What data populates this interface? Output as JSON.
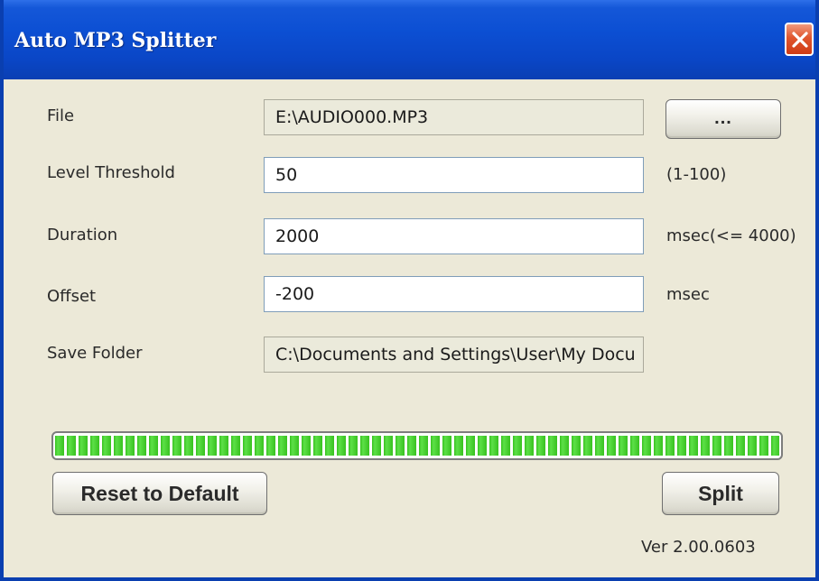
{
  "window": {
    "title": "Auto MP3 Splitter"
  },
  "form": {
    "file": {
      "label": "File",
      "value": "E:\\AUDIO000.MP3",
      "browse_label": "..."
    },
    "level_threshold": {
      "label": "Level Threshold",
      "value": "50",
      "unit": "(1-100)"
    },
    "duration": {
      "label": "Duration",
      "value": "2000",
      "unit": "msec(<= 4000)"
    },
    "offset": {
      "label": "Offset",
      "value": "-200",
      "unit": "msec"
    },
    "save_folder": {
      "label": "Save Folder",
      "value": "C:\\Documents and Settings\\User\\My Docu"
    }
  },
  "progress": {
    "percent": 100,
    "color": "#38c21f"
  },
  "buttons": {
    "reset_label": "Reset to Default",
    "split_label": "Split"
  },
  "version": "Ver 2.00.0603",
  "icons": {
    "close": "close-icon"
  }
}
